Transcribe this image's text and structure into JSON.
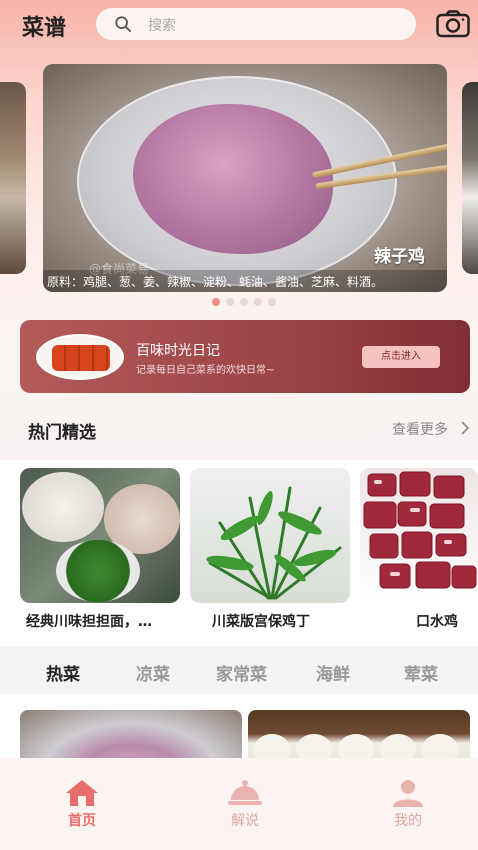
{
  "header": {
    "title": "菜谱",
    "search_placeholder": "搜索",
    "search_icon": "search-icon",
    "camera_icon": "camera-icon"
  },
  "banner": {
    "title": "辣子鸡",
    "watermark": "@食尚菜易",
    "description": "原料：鸡腿、葱、姜、辣椒、淀粉、蚝油、酱油、芝麻、料酒。",
    "dot_count": 5,
    "active_dot": 0
  },
  "diary": {
    "title": "百味时光日记",
    "subtitle": "记录每日自己菜系的欢快日常~",
    "button_label": "点击进入"
  },
  "hot_section": {
    "title": "热门精选",
    "more_label": "查看更多",
    "items": [
      {
        "label": "经典川味担担面，…"
      },
      {
        "label": "川菜版宫保鸡丁"
      },
      {
        "label": "口水鸡"
      }
    ]
  },
  "tabs": [
    {
      "label": "热菜",
      "active": true
    },
    {
      "label": "凉菜",
      "active": false
    },
    {
      "label": "家常菜",
      "active": false
    },
    {
      "label": "海鲜",
      "active": false
    },
    {
      "label": "荤菜",
      "active": false
    }
  ],
  "bottom_nav": [
    {
      "label": "首页",
      "icon": "home-icon",
      "active": true
    },
    {
      "label": "解说",
      "icon": "cloche-icon",
      "active": false
    },
    {
      "label": "我的",
      "icon": "user-icon",
      "active": false
    }
  ],
  "colors": {
    "accent": "#e96e69",
    "diary_bg": "#9b4446",
    "dot_active": "#ee8d86"
  }
}
